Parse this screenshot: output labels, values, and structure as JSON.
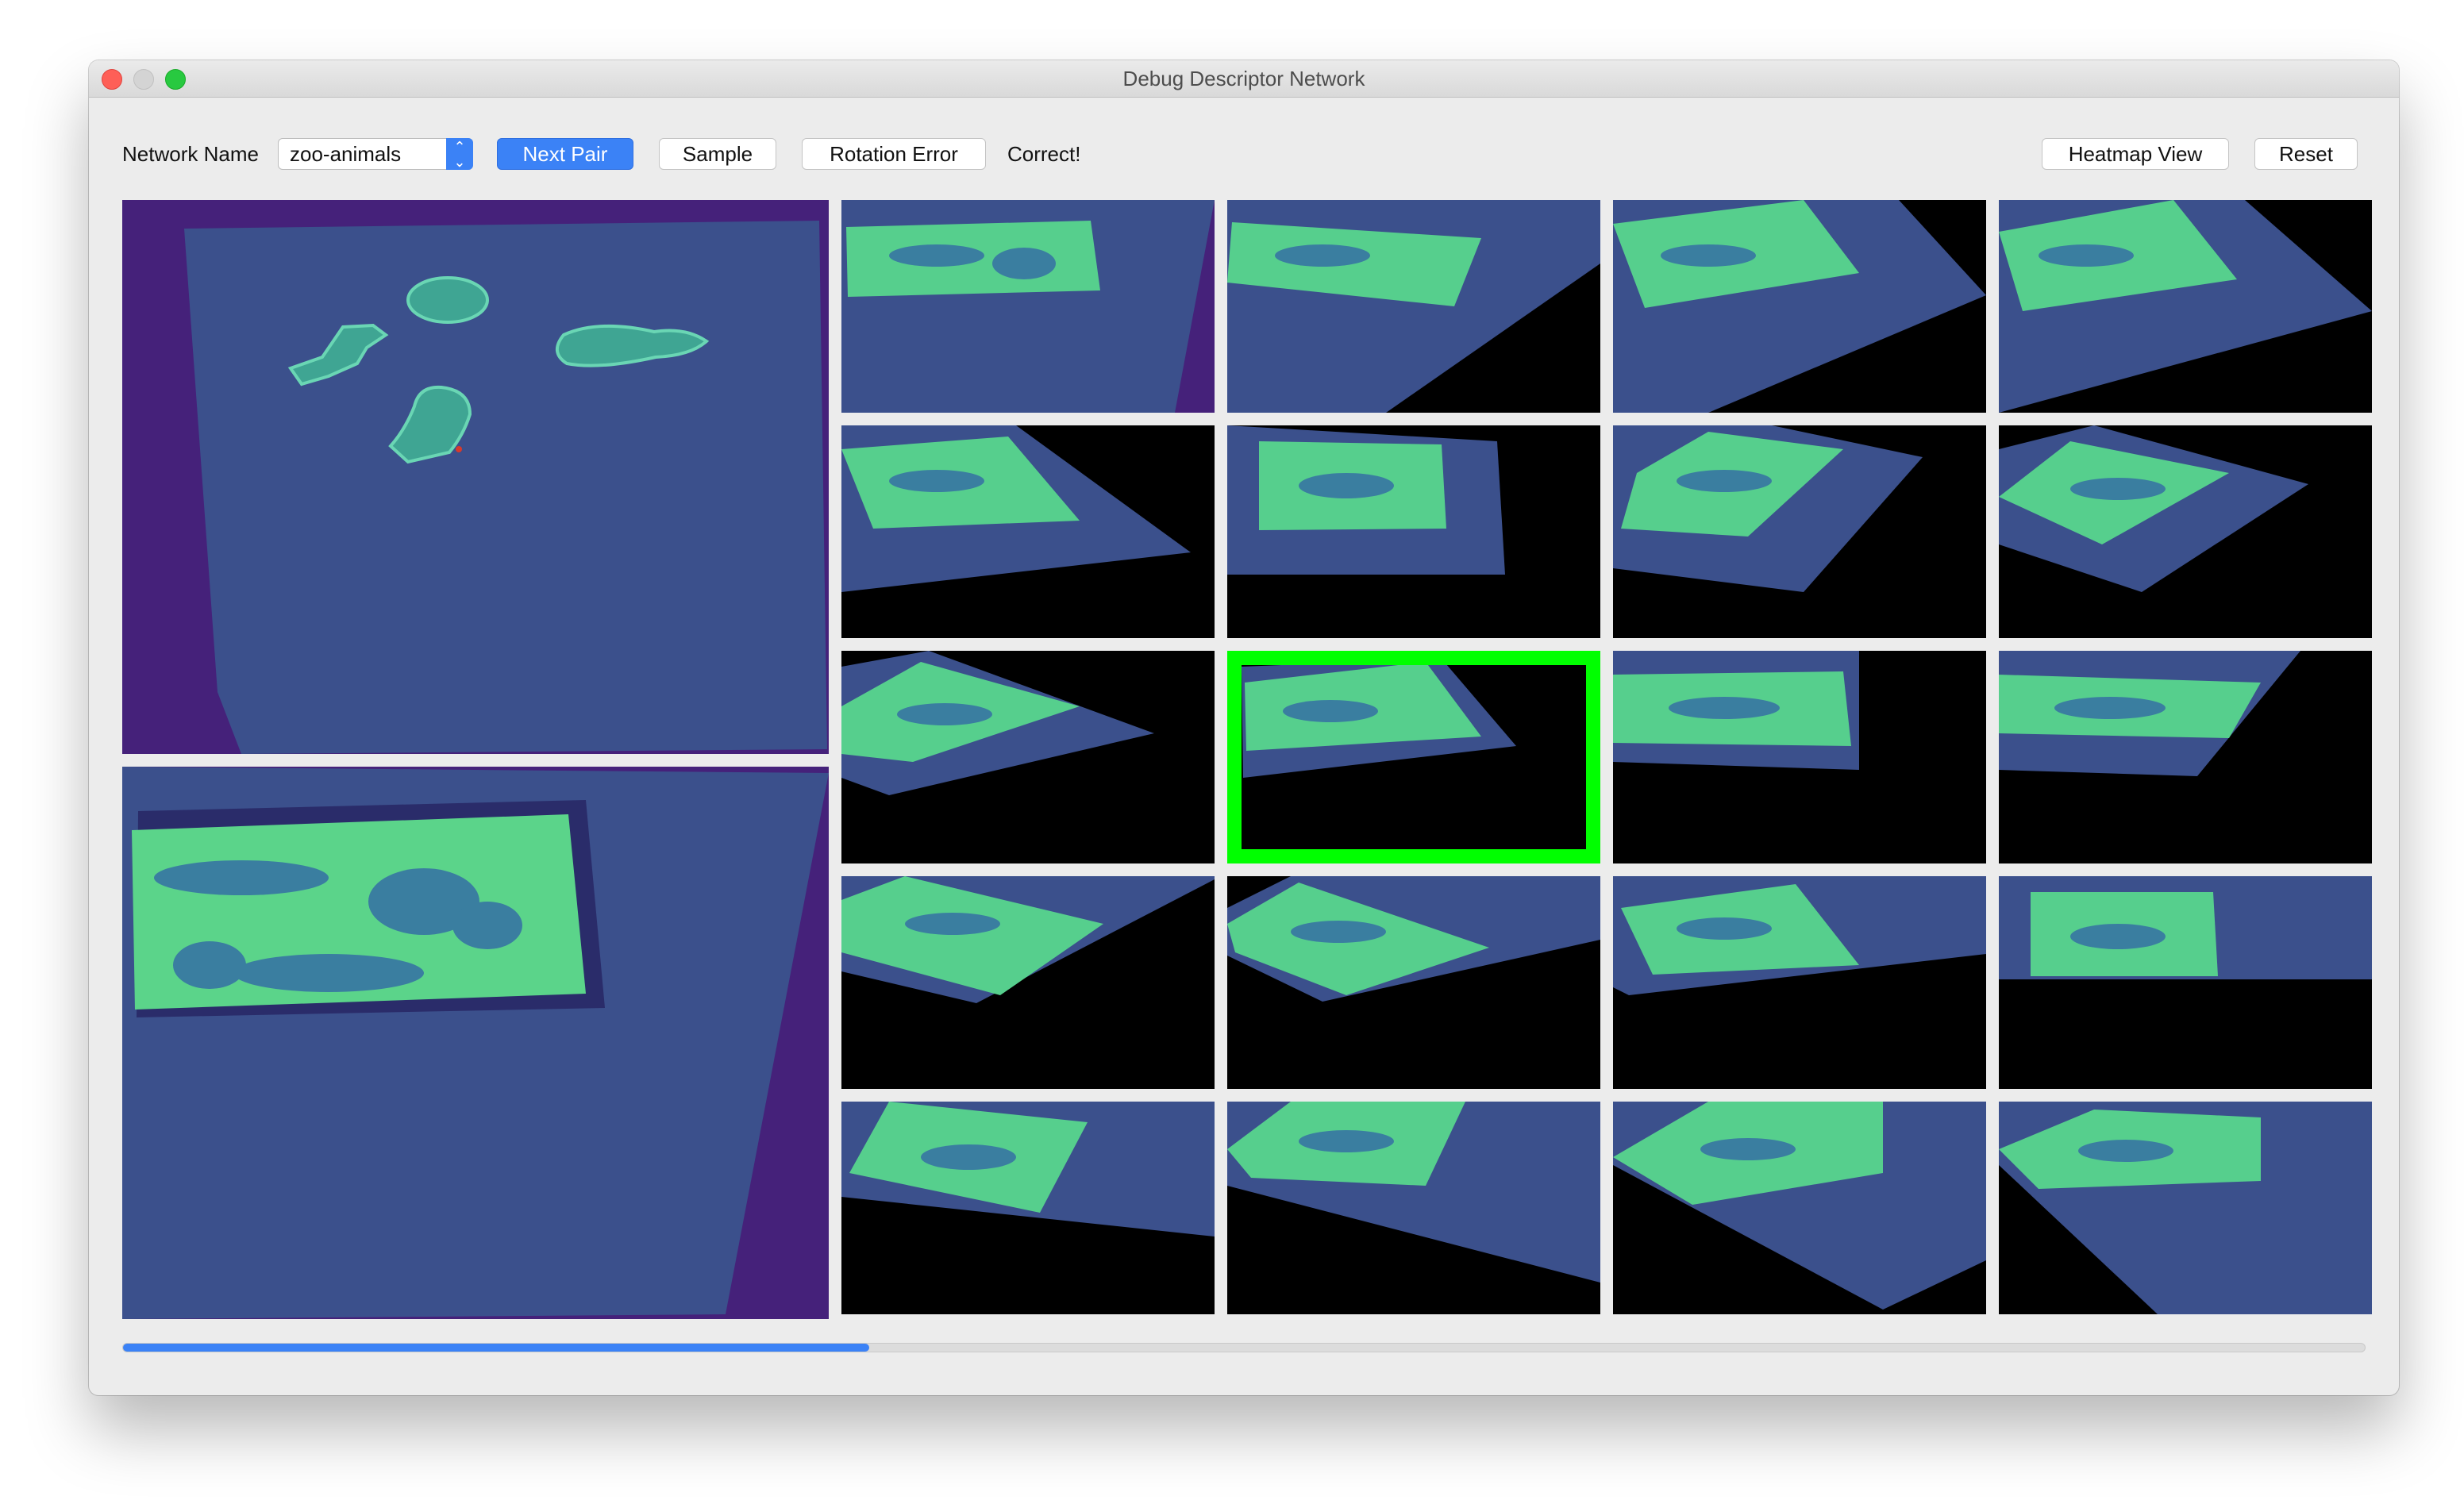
{
  "window": {
    "title": "Debug Descriptor Network"
  },
  "toolbar": {
    "network_label": "Network Name",
    "network_value": "zoo-animals",
    "next_pair": "Next Pair",
    "sample": "Sample",
    "rotation_error": "Rotation Error",
    "status": "Correct!",
    "heatmap_view": "Heatmap View",
    "reset": "Reset"
  },
  "colors": {
    "accent": "#3b82f6",
    "highlight": "#00ff00",
    "board_dark": "#45217a",
    "board_mid": "#3b508c",
    "board_bright": "#4ed08a"
  },
  "grid": {
    "rows": 5,
    "cols": 4,
    "highlighted_index": 9
  },
  "progress": {
    "fraction": 0.333
  }
}
